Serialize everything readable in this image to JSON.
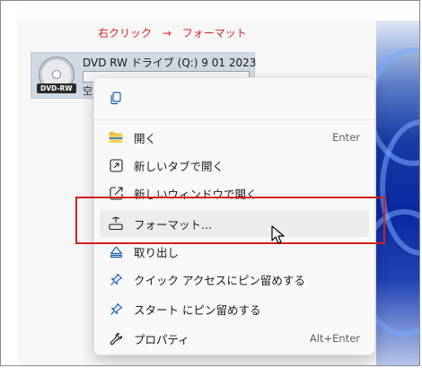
{
  "annotation": {
    "step1": "右クリック",
    "arrow": "→",
    "step2": "フォーマット"
  },
  "drive": {
    "name": "DVD RW ドライブ (Q:) 9 01 2023",
    "badge": "DVD-RW",
    "free_space": "空"
  },
  "context_menu": {
    "toolbar": {
      "copy_icon": "copy-icon"
    },
    "items": [
      {
        "label": "開く",
        "shortcut": "Enter",
        "icon": "folder-icon"
      },
      {
        "label": "新しいタブで開く",
        "shortcut": "",
        "icon": "new-tab-icon"
      },
      {
        "label": "新しいウィンドウで開く",
        "shortcut": "",
        "icon": "new-window-icon"
      },
      {
        "label": "フォーマット...",
        "shortcut": "",
        "icon": "format-drive-icon"
      },
      {
        "label": "取り出し",
        "shortcut": "",
        "icon": "eject-icon"
      },
      {
        "label": "クイック アクセスにピン留めする",
        "shortcut": "",
        "icon": "pin-icon"
      },
      {
        "label": "スタート にピン留めする",
        "shortcut": "",
        "icon": "pin-icon"
      },
      {
        "label": "プロパティ",
        "shortcut": "Alt+Enter",
        "icon": "wrench-icon"
      }
    ]
  },
  "colors": {
    "annotation": "#d32424",
    "highlight_box": "#d21f1f",
    "menu_bg": "#f9f9f9",
    "icon_blue": "#1a5fb4"
  }
}
